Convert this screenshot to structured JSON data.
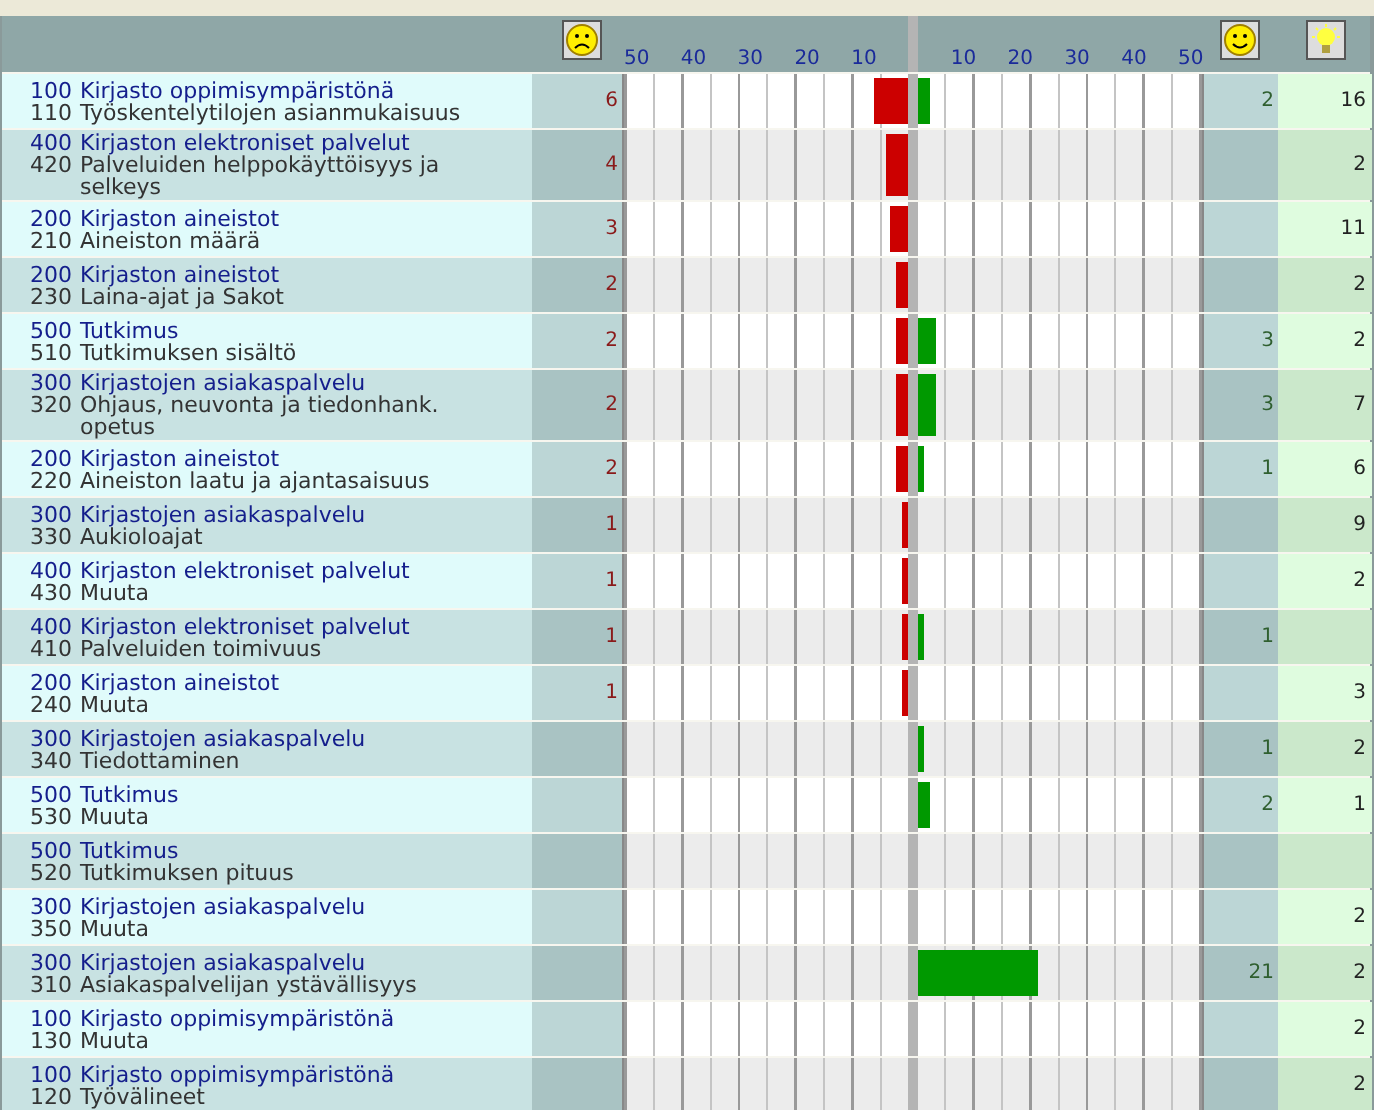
{
  "header": {
    "negative_ticks": [
      "50",
      "40",
      "30",
      "20",
      "10"
    ],
    "positive_ticks": [
      "10",
      "20",
      "30",
      "40",
      "50"
    ]
  },
  "rows": [
    {
      "category_code": "100",
      "category": "Kirjasto oppimisympäristönä",
      "item_code": "110",
      "item": "Työskentelytilojen asianmukaisuus",
      "negative": {
        "count": "6",
        "level": 0.12
      },
      "positive": {
        "count": "2",
        "level": 0.04
      },
      "ideas": "16"
    },
    {
      "category_code": "400",
      "category": "Kirjaston elektroniset palvelut",
      "item_code": "420",
      "item": "Palveluiden helppokäyttöisyys ja selkeys",
      "negative": {
        "count": "4",
        "level": 0.08
      },
      "ideas": "2"
    },
    {
      "category_code": "200",
      "category": "Kirjaston aineistot",
      "item_code": "210",
      "item": "Aineiston määrä",
      "negative": {
        "count": "3",
        "level": 0.06
      },
      "ideas": "11"
    },
    {
      "category_code": "200",
      "category": "Kirjaston aineistot",
      "item_code": "230",
      "item": "Laina-ajat ja Sakot",
      "negative": {
        "count": "2",
        "level": 0.04
      },
      "ideas": "2"
    },
    {
      "category_code": "500",
      "category": "Tutkimus",
      "item_code": "510",
      "item": "Tutkimuksen sisältö",
      "negative": {
        "count": "2",
        "level": 0.04
      },
      "positive": {
        "count": "3",
        "level": 0.06
      },
      "ideas": "2"
    },
    {
      "category_code": "300",
      "category": "Kirjastojen asiakaspalvelu",
      "item_code": "320",
      "item": "Ohjaus, neuvonta ja tiedonhank. opetus",
      "negative": {
        "count": "2",
        "level": 0.04
      },
      "positive": {
        "count": "3",
        "level": 0.06
      },
      "ideas": "7"
    },
    {
      "category_code": "200",
      "category": "Kirjaston aineistot",
      "item_code": "220",
      "item": "Aineiston laatu ja ajantasaisuus",
      "negative": {
        "count": "2",
        "level": 0.04
      },
      "positive": {
        "count": "1",
        "level": 0.02
      },
      "ideas": "6"
    },
    {
      "category_code": "300",
      "category": "Kirjastojen asiakaspalvelu",
      "item_code": "330",
      "item": "Aukioloajat",
      "negative": {
        "count": "1",
        "level": 0.02
      },
      "ideas": "9"
    },
    {
      "category_code": "400",
      "category": "Kirjaston elektroniset palvelut",
      "item_code": "430",
      "item": "Muuta",
      "negative": {
        "count": "1",
        "level": 0.02
      },
      "ideas": "2"
    },
    {
      "category_code": "400",
      "category": "Kirjaston elektroniset palvelut",
      "item_code": "410",
      "item": "Palveluiden toimivuus",
      "negative": {
        "count": "1",
        "level": 0.02
      },
      "positive": {
        "count": "1",
        "level": 0.02
      }
    },
    {
      "category_code": "200",
      "category": "Kirjaston aineistot",
      "item_code": "240",
      "item": "Muuta",
      "negative": {
        "count": "1",
        "level": 0.02
      },
      "ideas": "3"
    },
    {
      "category_code": "300",
      "category": "Kirjastojen asiakaspalvelu",
      "item_code": "340",
      "item": "Tiedottaminen",
      "positive": {
        "count": "1",
        "level": 0.02
      },
      "ideas": "2"
    },
    {
      "category_code": "500",
      "category": "Tutkimus",
      "item_code": "530",
      "item": "Muuta",
      "positive": {
        "count": "2",
        "level": 0.04
      },
      "ideas": "1"
    },
    {
      "category_code": "500",
      "category": "Tutkimus",
      "item_code": "520",
      "item": "Tutkimuksen pituus"
    },
    {
      "category_code": "300",
      "category": "Kirjastojen asiakaspalvelu",
      "item_code": "350",
      "item": "Muuta",
      "ideas": "2"
    },
    {
      "category_code": "300",
      "category": "Kirjastojen asiakaspalvelu",
      "item_code": "310",
      "item": "Asiakaspalvelijan ystävällisyys",
      "positive": {
        "count": "21",
        "level": 0.42
      },
      "ideas": "2"
    },
    {
      "category_code": "100",
      "category": "Kirjasto oppimisympäristönä",
      "item_code": "130",
      "item": "Muuta",
      "ideas": "2"
    },
    {
      "category_code": "100",
      "category": "Kirjasto oppimisympäristönä",
      "item_code": "120",
      "item": "Työvälineet",
      "ideas": "2"
    }
  ]
}
